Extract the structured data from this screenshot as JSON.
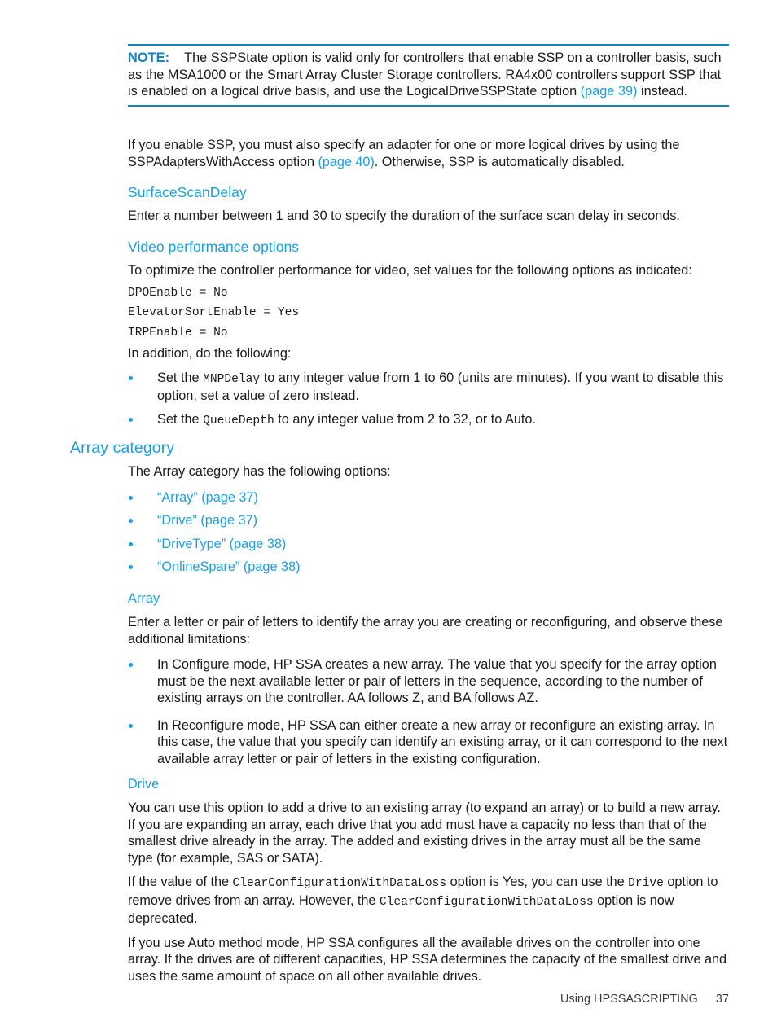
{
  "note": {
    "label": "NOTE:",
    "text_1": "The SSPState option is valid only for controllers that enable SSP on a controller basis, such as the MSA1000 or the Smart Array Cluster Storage controllers. RA4x00 controllers support SSP that is enabled on a logical drive basis, and use the LogicalDriveSSPState option ",
    "link_1": "(page 39)",
    "text_2": " instead."
  },
  "ssp_para": {
    "text_1": "If you enable SSP, you must also specify an adapter for one or more logical drives by using the SSPAdaptersWithAccess option ",
    "link_1": "(page 40)",
    "text_2": ". Otherwise, SSP is automatically disabled."
  },
  "surface_scan": {
    "heading": "SurfaceScanDelay",
    "body": "Enter a number between 1 and 30 to specify the duration of the surface scan delay in seconds."
  },
  "video": {
    "heading": "Video performance options",
    "intro": "To optimize the controller performance for video, set values for the following options as indicated:",
    "code_lines": [
      "DPOEnable = No",
      "ElevatorSortEnable = Yes",
      "IRPEnable = No"
    ],
    "addition_intro": "In addition, do the following:",
    "bullets": [
      {
        "pre": "Set the ",
        "code": "MNPDelay",
        "post": " to any integer value from 1 to 60 (units are minutes). If you want to disable this option, set a value of zero instead."
      },
      {
        "pre": "Set the ",
        "code": "QueueDepth",
        "post": " to any integer value from 2 to 32, or to Auto."
      }
    ]
  },
  "array_category": {
    "heading": "Array category",
    "intro": "The Array category has the following options:",
    "links": [
      "“Array” (page 37)",
      "“Drive” (page 37)",
      "“DriveType” (page 38)",
      "“OnlineSpare” (page 38)"
    ]
  },
  "array": {
    "heading": "Array",
    "intro": "Enter a letter or pair of letters to identify the array you are creating or reconfiguring, and observe these additional limitations:",
    "bullets": [
      "In Configure mode, HP SSA creates a new array. The value that you specify for the array option must be the next available letter or pair of letters in the sequence, according to the number of existing arrays on the controller. AA follows Z, and BA follows AZ.",
      "In Reconfigure mode, HP SSA can either create a new array or reconfigure an existing array. In this case, the value that you specify can identify an existing array, or it can correspond to the next available array letter or pair of letters in the existing configuration."
    ]
  },
  "drive": {
    "heading": "Drive",
    "para_1": "You can use this option to add a drive to an existing array (to expand an array) or to build a new array. If you are expanding an array, each drive that you add must have a capacity no less than that of the smallest drive already in the array. The added and existing drives in the array must all be the same type (for example, SAS or SATA).",
    "para_2": {
      "text_1": "If the value of the ",
      "code_1": "ClearConfigurationWithDataLoss",
      "text_2": " option is Yes, you can use the ",
      "code_2": "Drive",
      "text_3": " option to remove drives from an array. However, the ",
      "code_3": "ClearConfigurationWithDataLoss",
      "text_4": " option is now deprecated."
    },
    "para_3": "If you use Auto method mode, HP SSA configures all the available drives on the controller into one array. If the drives are of different capacities, HP SSA determines the capacity of the smallest drive and uses the same amount of space on all other available drives."
  },
  "footer": {
    "text": "Using HPSSASCRIPTING",
    "page_number": "37"
  },
  "colors": {
    "link": "#19a0e0",
    "heading": "#19a0e0",
    "note_rule": "#0e83bd",
    "body": "#1a1a1a"
  }
}
